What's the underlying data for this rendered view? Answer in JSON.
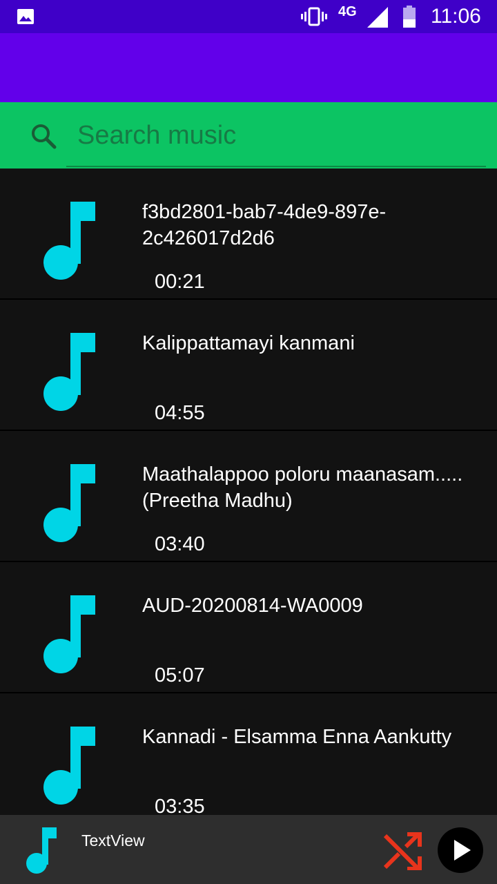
{
  "status_bar": {
    "network": "4G",
    "time": "11:06",
    "icons": [
      "gallery-icon",
      "vibrate-icon",
      "signal-icon",
      "battery-icon"
    ]
  },
  "search": {
    "placeholder": "Search music",
    "value": ""
  },
  "songs": [
    {
      "title": "f3bd2801-bab7-4de9-897e-2c426017d2d6",
      "duration": "00:21"
    },
    {
      "title": "Kalippattamayi kanmani",
      "duration": "04:55"
    },
    {
      "title": "Maathalappoo poloru maanasam.....(Preetha Madhu)",
      "duration": "03:40"
    },
    {
      "title": "AUD-20200814-WA0009",
      "duration": "05:07"
    },
    {
      "title": "Kannadi - Elsamma Enna Aankutty",
      "duration": "03:35"
    }
  ],
  "player": {
    "label": "TextView"
  },
  "colors": {
    "status_bar": "#3f00c8",
    "app_bar": "#6200ea",
    "search_bar": "#0cc463",
    "note_icon": "#00d5e6",
    "shuffle": "#e8341c",
    "background": "#121212"
  }
}
